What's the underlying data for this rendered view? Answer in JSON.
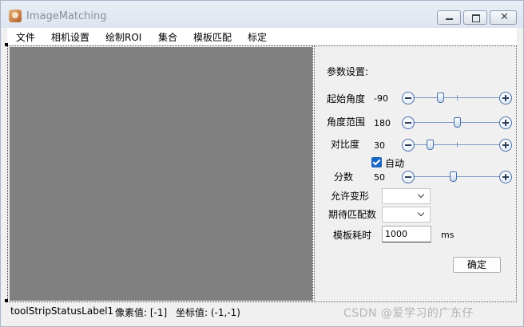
{
  "window": {
    "title": "ImageMatching",
    "close_glyph": "✕"
  },
  "menu": {
    "items": [
      "文件",
      "相机设置",
      "绘制ROI",
      "集合",
      "模板匹配",
      "标定"
    ]
  },
  "panel": {
    "header": "参数设置:",
    "start_angle": {
      "label": "起始角度",
      "value": "-90",
      "level": 0.3
    },
    "angle_range": {
      "label": "角度范围",
      "value": "180",
      "level": 0.5
    },
    "contrast": {
      "label": "对比度",
      "value": "30",
      "level": 0.18
    },
    "auto_checkbox": {
      "label": "自动",
      "checked": true
    },
    "score": {
      "label": "分数",
      "value": "50",
      "level": 0.45
    },
    "allow_deform": {
      "label": "允许变形",
      "selected": ""
    },
    "expected_matches": {
      "label": "期待匹配数",
      "selected": ""
    },
    "template_time": {
      "label": "模板耗时",
      "value": "1000",
      "unit": "ms"
    },
    "ok_button": "确定"
  },
  "status": {
    "label1": "toolStripStatusLabel1",
    "pixel_label": "像素值: [-1]",
    "coord_label": "坐标值: (-1,-1)"
  },
  "watermark": "CSDN @爱学习的广东仔",
  "colors": {
    "canvas": "#808080",
    "accent": "#1a66c2",
    "window_bg": "#f0f0f0"
  }
}
